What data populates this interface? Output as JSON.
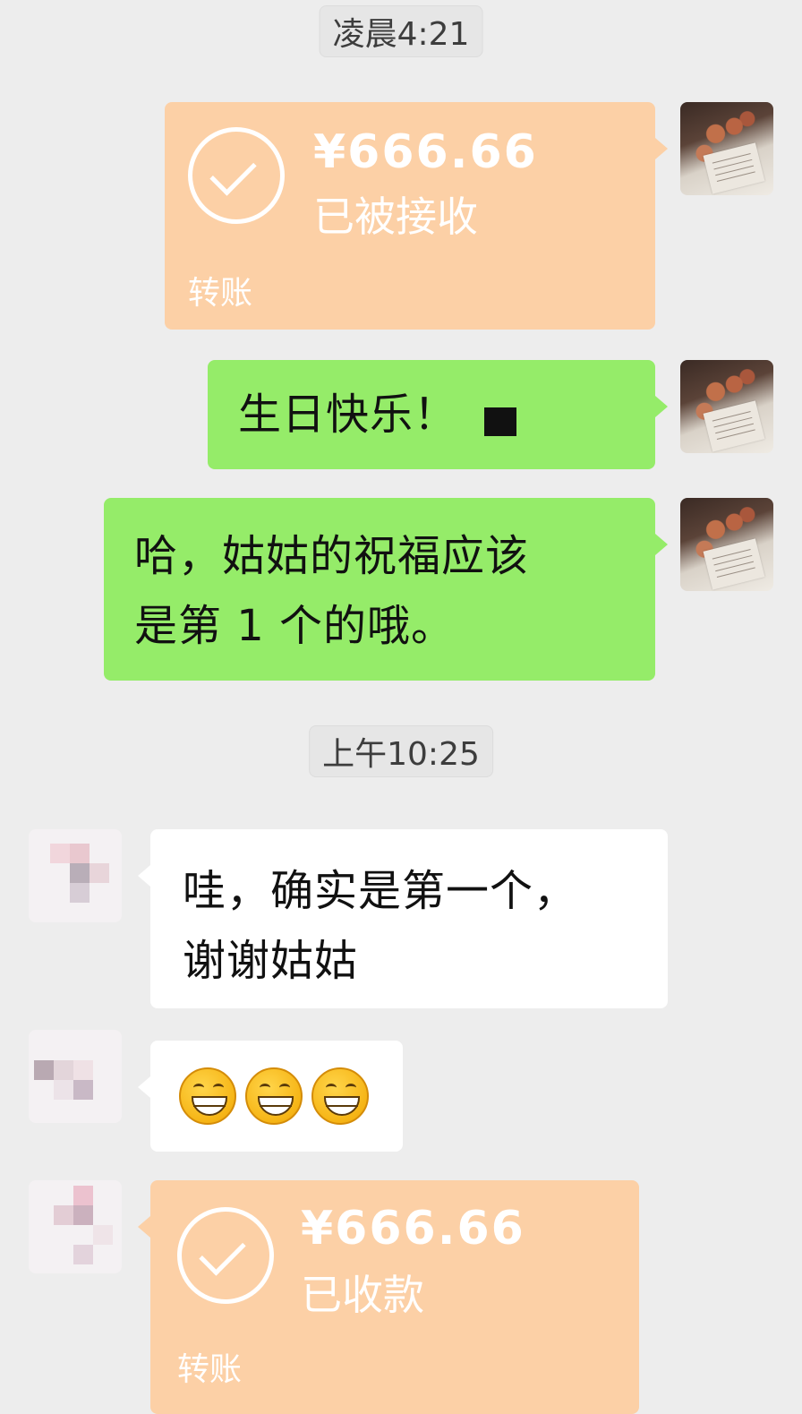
{
  "timestamps": {
    "early": "凌晨4:21",
    "morning": "上午10:25"
  },
  "messages": {
    "transfer_sent": {
      "amount": "¥666.66",
      "status": "已被接收",
      "label": "转账"
    },
    "birthday": "生日快乐！",
    "blessing_line1": "哈，姑姑的祝福应该",
    "blessing_line2": "是第 1 个的哦。",
    "reply_line1": "哇，确实是第一个，",
    "reply_line2": "谢谢姑姑",
    "emoji_reply": {
      "icons": [
        "grinning-face-icon",
        "grinning-face-icon",
        "grinning-face-icon"
      ]
    },
    "transfer_received": {
      "amount": "¥666.66",
      "status": "已收款",
      "label": "转账"
    }
  },
  "colors": {
    "background": "#ededed",
    "self_bubble": "#95ec69",
    "other_bubble": "#ffffff",
    "transfer_card": "#fcd0a6"
  }
}
